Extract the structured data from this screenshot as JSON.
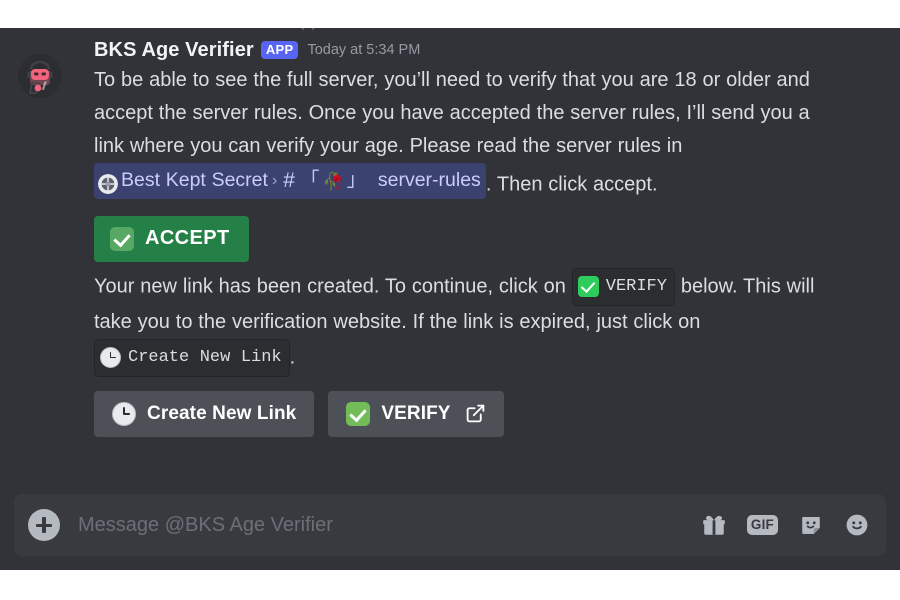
{
  "window": {
    "clipped_top_text": "· ·"
  },
  "message": {
    "author": "BKS Age Verifier",
    "badge": "APP",
    "timestamp": "Today at 5:34 PM",
    "avatar_icon": "robot-avatar",
    "paragraph1_part1": "To be able to see the full server, you’ll need to verify that you are 18 or older and accept the server rules. Once you have accepted the server rules, I’ll send you a link where you can verify your age. Please read the server rules in ",
    "paragraph1_part2": ". Then click accept.",
    "channel_mention": {
      "guild_name": "Best Kept Secret",
      "separator": "›",
      "hash": "#",
      "bracket_open": "「",
      "emoji": "🥀",
      "bracket_close": "」",
      "channel_name": "server-rules"
    },
    "accept_button": {
      "label": "ACCEPT",
      "emoji": "white-check-mark",
      "color": "#248046"
    },
    "paragraph2_part1": "Your new link has been created. To continue, click on ",
    "paragraph2_code1": "VERIFY",
    "paragraph2_part2": " below. This will take you to the verification website. If the link is expired, just click on ",
    "paragraph2_code2": "Create New Link",
    "paragraph2_part3": ".",
    "buttons": [
      {
        "label": "Create New Link",
        "emoji": "clock-icon",
        "external": false
      },
      {
        "label": "VERIFY",
        "emoji": "white-check-mark",
        "external": true
      }
    ]
  },
  "input_bar": {
    "placeholder": "Message @BKS Age Verifier",
    "value": "",
    "add_label": "+",
    "icons": [
      {
        "name": "gift-icon",
        "label": ""
      },
      {
        "name": "gif-icon",
        "label": "GIF"
      },
      {
        "name": "sticker-icon",
        "label": ""
      },
      {
        "name": "emoji-icon",
        "label": ""
      }
    ]
  },
  "colors": {
    "chat_background": "#313338",
    "input_background": "#383A40",
    "brand_blurple": "#5865F2",
    "accept_green": "#248046",
    "mention_background": "#3C4270",
    "mention_text": "#C9CDFB"
  }
}
